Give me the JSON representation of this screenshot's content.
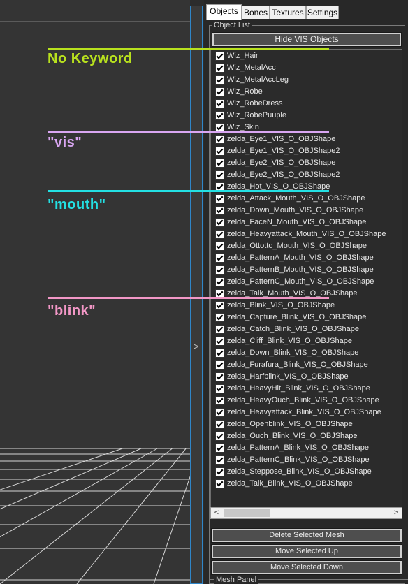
{
  "annotations": [
    {
      "label": "No Keyword",
      "color": "#b8e11e"
    },
    {
      "label": "\"vis\"",
      "color": "#d9a6f2"
    },
    {
      "label": "\"mouth\"",
      "color": "#23e0e3"
    },
    {
      "label": "\"blink\"",
      "color": "#f297c6"
    }
  ],
  "splitter": {
    "arrow": ">"
  },
  "tabs": [
    "Objects",
    "Bones",
    "Textures",
    "Settings"
  ],
  "object_list": {
    "title": "Object List",
    "hide_vis_button": "Hide VIS Objects",
    "items": [
      "Wiz_Hair",
      "Wiz_MetalAcc",
      "Wiz_MetalAccLeg",
      "Wiz_Robe",
      "Wiz_RobeDress",
      "Wiz_RobePuuple",
      "Wiz_Skin",
      "zelda_Eye1_VIS_O_OBJShape",
      "zelda_Eye1_VIS_O_OBJShape2",
      "zelda_Eye2_VIS_O_OBJShape",
      "zelda_Eye2_VIS_O_OBJShape2",
      "zelda_Hot_VIS_O_OBJShape",
      "zelda_Attack_Mouth_VIS_O_OBJShape",
      "zelda_Down_Mouth_VIS_O_OBJShape",
      "zelda_FaceN_Mouth_VIS_O_OBJShape",
      "zelda_Heavyattack_Mouth_VIS_O_OBJShape",
      "zelda_Ottotto_Mouth_VIS_O_OBJShape",
      "zelda_PatternA_Mouth_VIS_O_OBJShape",
      "zelda_PatternB_Mouth_VIS_O_OBJShape",
      "zelda_PatternC_Mouth_VIS_O_OBJShape",
      "zelda_Talk_Mouth_VIS_O_OBJShape",
      "zelda_Blink_VIS_O_OBJShape",
      "zelda_Capture_Blink_VIS_O_OBJShape",
      "zelda_Catch_Blink_VIS_O_OBJShape",
      "zelda_Cliff_Blink_VIS_O_OBJShape",
      "zelda_Down_Blink_VIS_O_OBJShape",
      "zelda_Furafura_Blink_VIS_O_OBJShape",
      "zelda_Harfblink_VIS_O_OBJShape",
      "zelda_HeavyHit_Blink_VIS_O_OBJShape",
      "zelda_HeavyOuch_Blink_VIS_O_OBJShape",
      "zelda_Heavyattack_Blink_VIS_O_OBJShape",
      "zelda_Openblink_VIS_O_OBJShape",
      "zelda_Ouch_Blink_VIS_O_OBJShape",
      "zelda_PatternA_Blink_VIS_O_OBJShape",
      "zelda_PatternC_Blink_VIS_O_OBJShape",
      "zelda_Steppose_Blink_VIS_O_OBJShape",
      "zelda_Talk_Blink_VIS_O_OBJShape"
    ]
  },
  "buttons": {
    "delete": "Delete Selected Mesh",
    "move_up": "Move Selected Up",
    "move_down": "Move Selected Down"
  },
  "mesh_panel": {
    "title": "Mesh Panel"
  },
  "scrollbar": {
    "left_arrow": "<",
    "right_arrow": ">"
  }
}
